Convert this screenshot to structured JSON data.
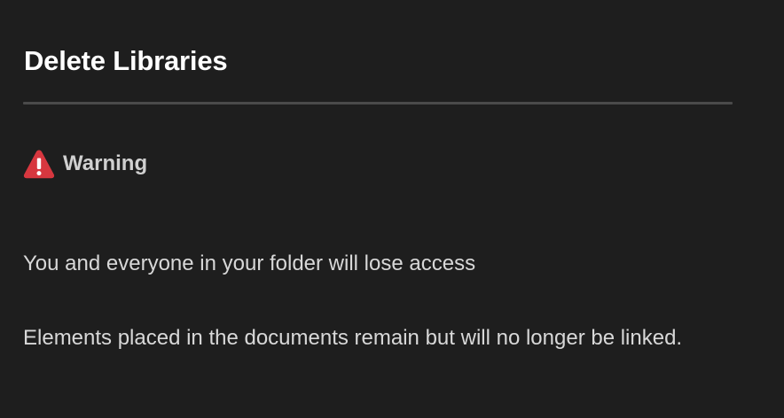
{
  "dialog": {
    "title": "Delete Libraries",
    "warning": {
      "icon": "alert-triangle-icon",
      "icon_color": "#d7373f",
      "label": "Warning"
    },
    "messages": [
      " You and everyone in your folder will lose access",
      " Elements placed in the documents remain but will no longer be linked."
    ]
  },
  "colors": {
    "background": "#1e1e1e",
    "title": "#ffffff",
    "text": "#d8d8d8",
    "divider": "#4a4a4a",
    "alert": "#d7373f"
  }
}
